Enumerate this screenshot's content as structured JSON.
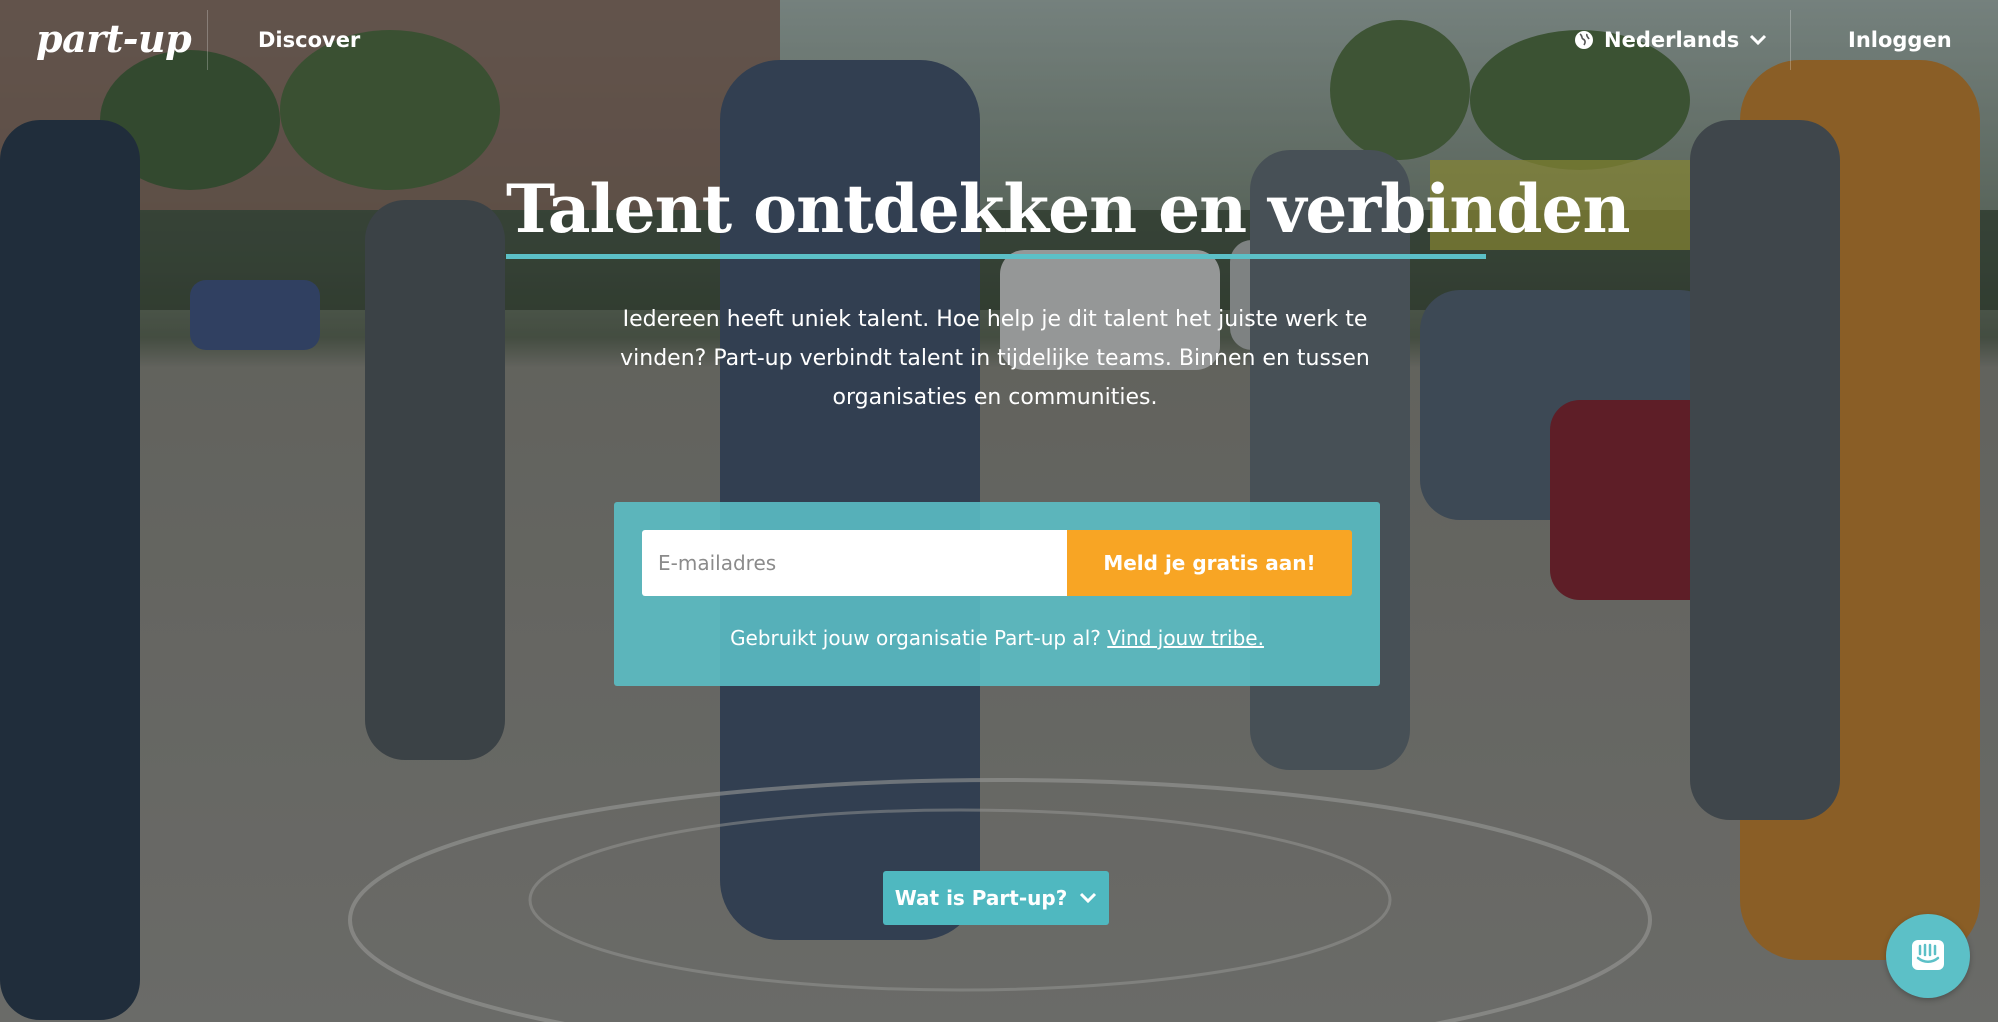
{
  "nav": {
    "logo": "part-up",
    "discover": "Discover",
    "language": "Nederlands",
    "login": "Inloggen"
  },
  "hero": {
    "headline": "Talent ontdekken en verbinden",
    "subtext": "Iedereen heeft uniek talent. Hoe help je dit talent het juiste werk te vinden? Part-up verbindt talent in tijdelijke teams. Binnen en tussen organisaties en communities."
  },
  "signup": {
    "email_placeholder": "E-mailadres",
    "button_label": "Meld je gratis aan!",
    "tribe_prompt": "Gebruikt jouw organisatie Part-up al?",
    "tribe_link": "Vind jouw tribe."
  },
  "what_button": "Wat is Part-up?",
  "colors": {
    "accent_teal": "#5cc0c7",
    "cta_orange": "#f8a524"
  },
  "icons": {
    "language": "globe-icon",
    "dropdown": "chevron-down-icon",
    "chat": "chat-icon"
  }
}
